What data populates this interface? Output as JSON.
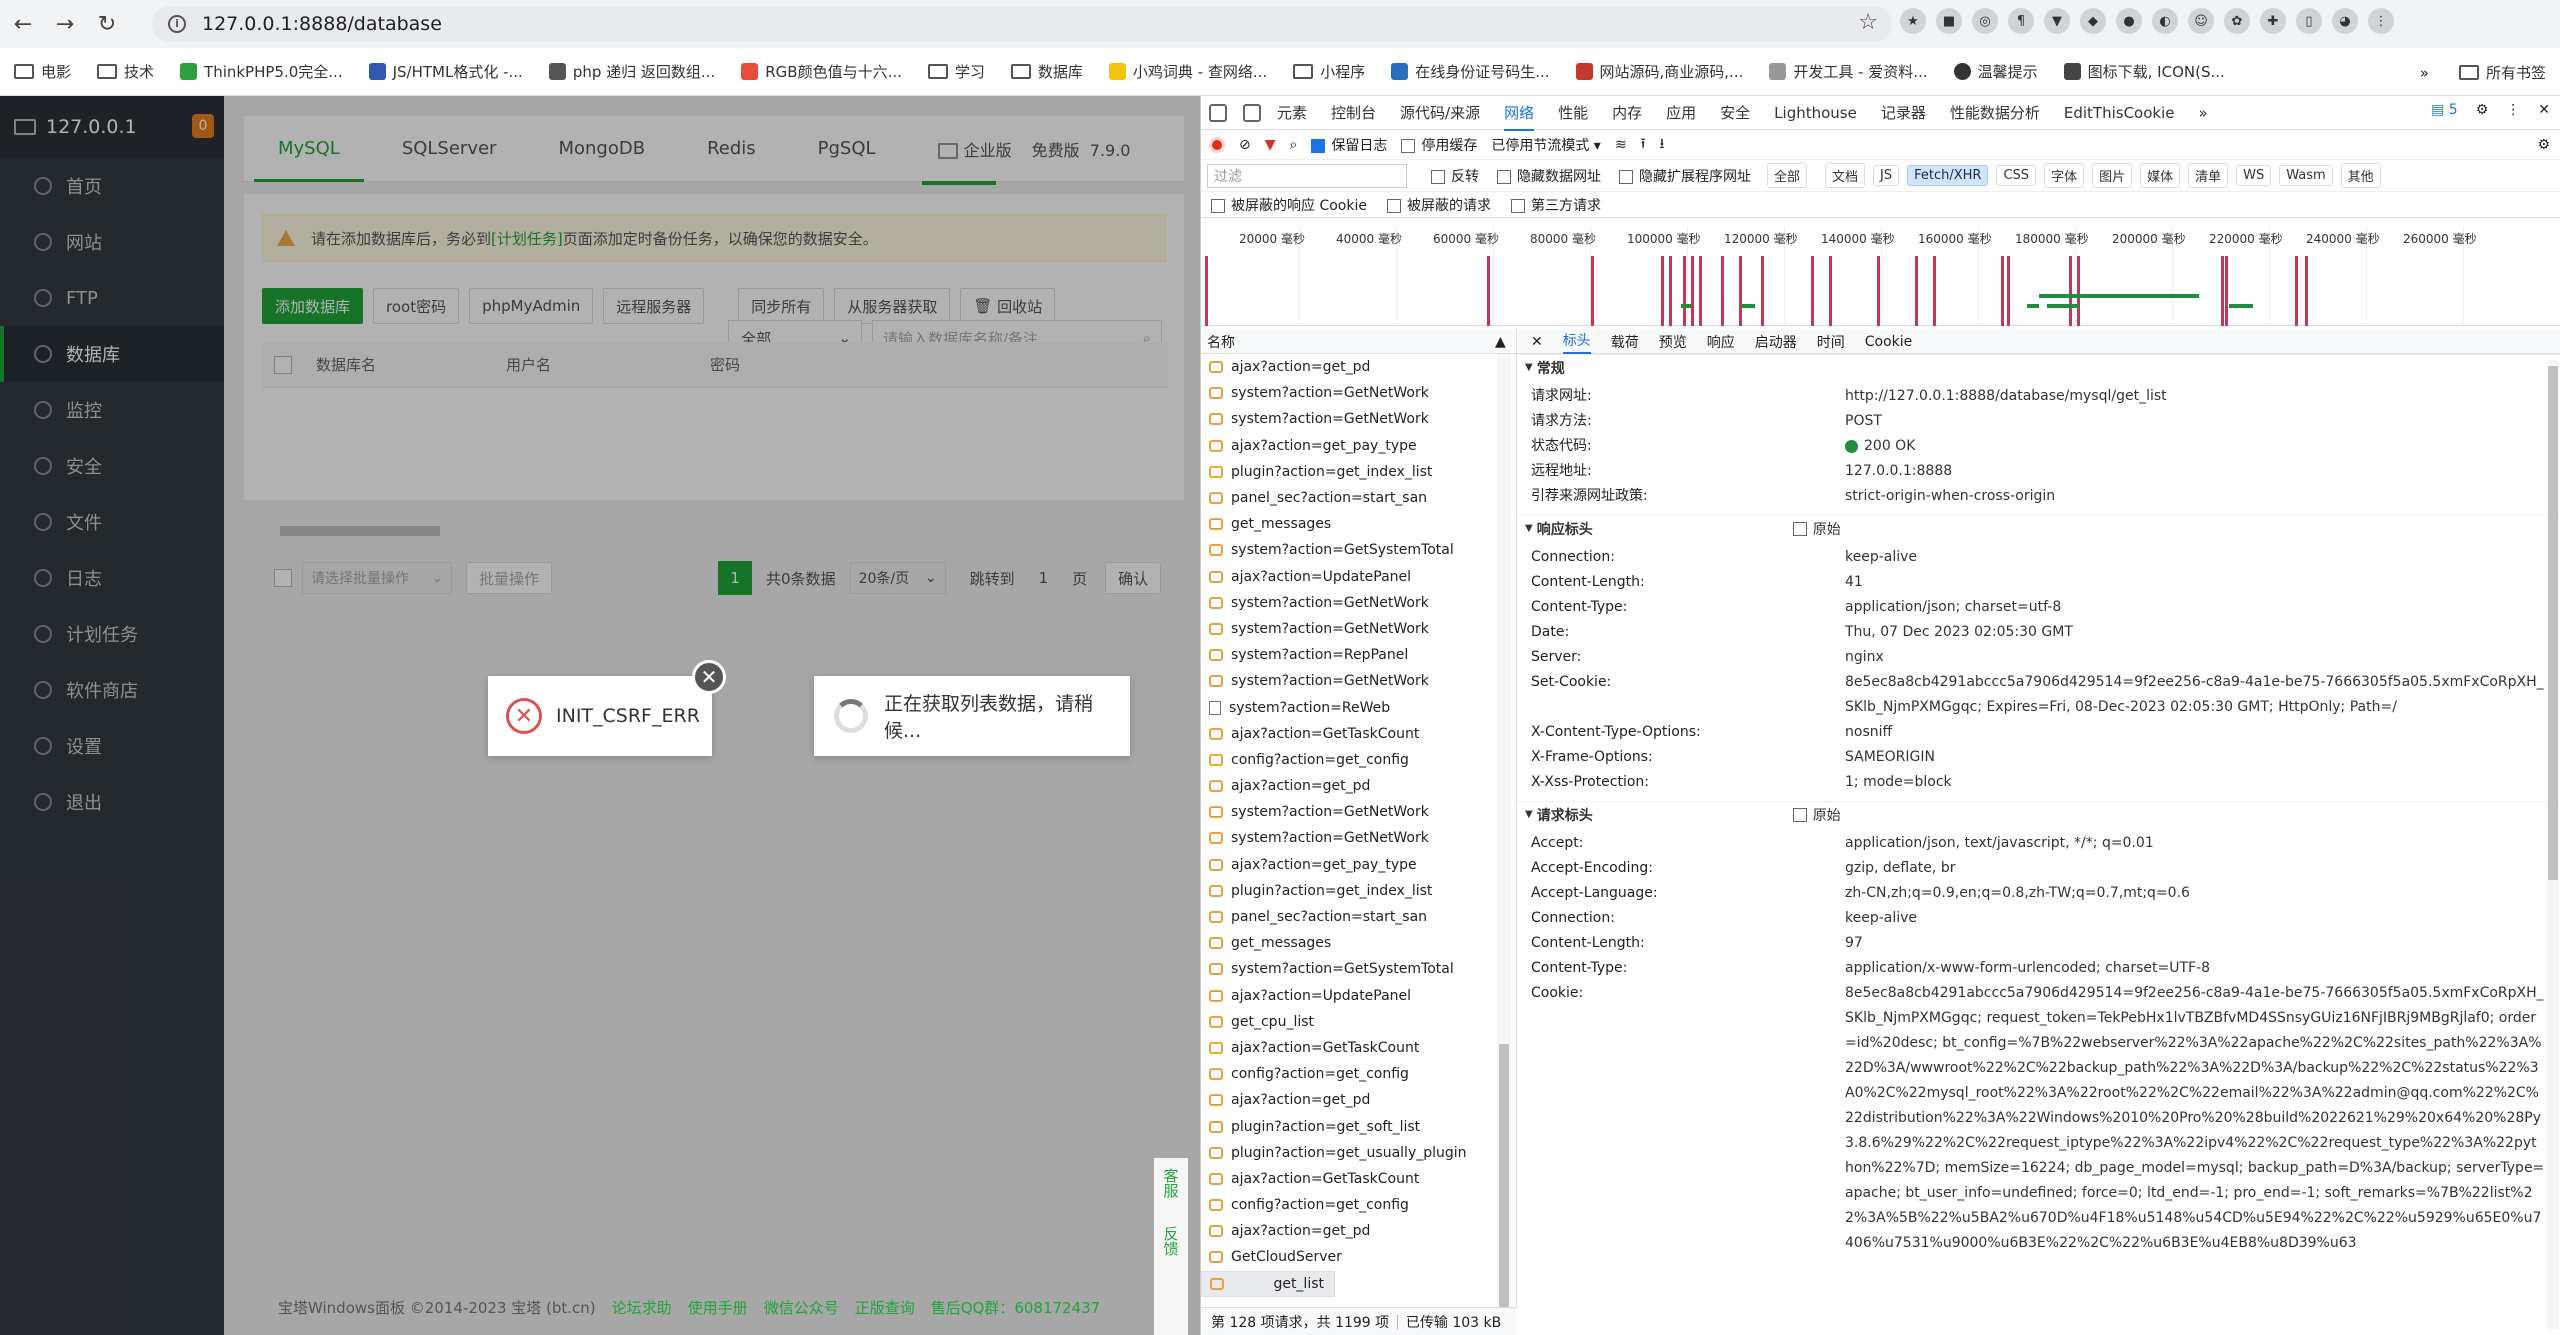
{
  "browser": {
    "url": "127.0.0.1:8888/database",
    "bookmarks": [
      "电影",
      "技术",
      "ThinkPHP5.0完全...",
      "JS/HTML格式化 -...",
      "php 递归 返回数组...",
      "RGB颜色值与十六...",
      "学习",
      "数据库",
      "小鸡词典 - 查网络...",
      "小程序",
      "在线身份证号码生...",
      "网站源码,商业源码,...",
      "开发工具 - 爱资料...",
      "温馨提示",
      "图标下载, ICON(S..."
    ],
    "bookmarks_overflow": "»",
    "all_bookmarks": "所有书签"
  },
  "panel": {
    "host": "127.0.0.1",
    "badge": "0",
    "sidebar": [
      "首页",
      "网站",
      "FTP",
      "数据库",
      "监控",
      "安全",
      "文件",
      "日志",
      "计划任务",
      "软件商店",
      "设置",
      "退出"
    ],
    "active_sidebar": "数据库",
    "tabs": [
      "MySQL",
      "SQLServer",
      "MongoDB",
      "Redis",
      "PgSQL"
    ],
    "pro_label": "企业版",
    "free_label": "免费版",
    "version": "7.9.0",
    "warning_before": "请在添加数据库后，务必到",
    "warning_link": "[计划任务]",
    "warning_after": "页面添加定时备份任务，以确保您的数据安全。",
    "toolbar": [
      "添加数据库",
      "root密码",
      "phpMyAdmin",
      "远程服务器",
      "同步所有",
      "从服务器获取",
      "回收站"
    ],
    "filter_all": "全部",
    "search_placeholder": "请输入数据库名称/备注",
    "columns": [
      "数据库名",
      "用户名",
      "密码"
    ],
    "batch_placeholder": "请选择批量操作",
    "batch_button": "批量操作",
    "page_current": "1",
    "total": "共0条数据",
    "per_page": "20条/页",
    "jump_label": "跳转到",
    "jump_value": "1",
    "page_label": "页",
    "confirm": "确认",
    "footer": {
      "copyright": "宝塔Windows面板 ©2014-2023 宝塔 (bt.cn)",
      "links": [
        "论坛求助",
        "使用手册",
        "微信公众号",
        "正版查询"
      ],
      "qq": "售后QQ群：608172437"
    },
    "float_kefu": "客服",
    "float_feedback": "反馈",
    "error_msg": "INIT_CSRF_ERR",
    "loading_msg": "正在获取列表数据，请稍候..."
  },
  "devtools": {
    "tabs": [
      "元素",
      "控制台",
      "源代码/来源",
      "网络",
      "性能",
      "内存",
      "应用",
      "安全",
      "Lighthouse",
      "记录器",
      "性能数据分析",
      "EditThisCookie"
    ],
    "active_tab": "网络",
    "issues_count": "5",
    "preserve_log": "保留日志",
    "disable_cache": "停用缓存",
    "throttle": "已停用节流模式",
    "filter_placeholder": "过滤",
    "invert": "反转",
    "hide_data_urls": "隐藏数据网址",
    "hide_ext_urls": "隐藏扩展程序网址",
    "types": [
      "全部",
      "文档",
      "JS",
      "Fetch/XHR",
      "CSS",
      "字体",
      "图片",
      "媒体",
      "清单",
      "WS",
      "Wasm",
      "其他"
    ],
    "active_type": "Fetch/XHR",
    "blocked_cookies": "被屏蔽的响应 Cookie",
    "blocked_requests": "被屏蔽的请求",
    "third_party": "第三方请求",
    "timeline": [
      "20000 毫秒",
      "40000 毫秒",
      "60000 毫秒",
      "80000 毫秒",
      "100000 毫秒",
      "120000 毫秒",
      "140000 毫秒",
      "160000 毫秒",
      "180000 毫秒",
      "200000 毫秒",
      "220000 毫秒",
      "240000 毫秒",
      "260000 毫秒"
    ],
    "name_header": "名称",
    "requests": [
      "ajax?action=get_pd",
      "system?action=GetNetWork",
      "system?action=GetNetWork",
      "ajax?action=get_pay_type",
      "plugin?action=get_index_list",
      "panel_sec?action=start_san",
      "get_messages",
      "system?action=GetSystemTotal",
      "ajax?action=UpdatePanel",
      "system?action=GetNetWork",
      "system?action=GetNetWork",
      "system?action=RepPanel",
      "system?action=GetNetWork",
      "system?action=ReWeb",
      "ajax?action=GetTaskCount",
      "config?action=get_config",
      "ajax?action=get_pd",
      "system?action=GetNetWork",
      "system?action=GetNetWork",
      "ajax?action=get_pay_type",
      "plugin?action=get_index_list",
      "panel_sec?action=start_san",
      "get_messages",
      "system?action=GetSystemTotal",
      "ajax?action=UpdatePanel",
      "get_cpu_list",
      "ajax?action=GetTaskCount",
      "config?action=get_config",
      "ajax?action=get_pd",
      "plugin?action=get_soft_list",
      "plugin?action=get_usually_plugin",
      "ajax?action=GetTaskCount",
      "config?action=get_config",
      "ajax?action=get_pd",
      "GetCloudServer",
      "get_list"
    ],
    "status_bar": [
      "第 128 项请求，共 1199 项",
      "已传输 103 kB"
    ],
    "detail_tabs": [
      "标头",
      "载荷",
      "预览",
      "响应",
      "启动器",
      "时间",
      "Cookie"
    ],
    "active_detail_tab": "标头",
    "general_title": "常规",
    "general": [
      {
        "k": "请求网址:",
        "v": "http://127.0.0.1:8888/database/mysql/get_list"
      },
      {
        "k": "请求方法:",
        "v": "POST"
      },
      {
        "k": "状态代码:",
        "v": "200 OK"
      },
      {
        "k": "远程地址:",
        "v": "127.0.0.1:8888"
      },
      {
        "k": "引荐来源网址政策:",
        "v": "strict-origin-when-cross-origin"
      }
    ],
    "response_title": "响应标头",
    "raw_label": "原始",
    "response_headers": [
      {
        "k": "Connection:",
        "v": "keep-alive"
      },
      {
        "k": "Content-Length:",
        "v": "41"
      },
      {
        "k": "Content-Type:",
        "v": "application/json; charset=utf-8"
      },
      {
        "k": "Date:",
        "v": "Thu, 07 Dec 2023 02:05:30 GMT"
      },
      {
        "k": "Server:",
        "v": "nginx"
      },
      {
        "k": "Set-Cookie:",
        "v": "8e5ec8a8cb4291abccc5a7906d429514=9f2ee256-c8a9-4a1e-be75-7666305f5a05.5xmFxCoRpXH_SKlb_NjmPXMGgqc; Expires=Fri, 08-Dec-2023 02:05:30 GMT; HttpOnly; Path=/"
      },
      {
        "k": "X-Content-Type-Options:",
        "v": "nosniff"
      },
      {
        "k": "X-Frame-Options:",
        "v": "SAMEORIGIN"
      },
      {
        "k": "X-Xss-Protection:",
        "v": "1; mode=block"
      }
    ],
    "request_title": "请求标头",
    "request_headers": [
      {
        "k": "Accept:",
        "v": "application/json, text/javascript, */*; q=0.01"
      },
      {
        "k": "Accept-Encoding:",
        "v": "gzip, deflate, br"
      },
      {
        "k": "Accept-Language:",
        "v": "zh-CN,zh;q=0.9,en;q=0.8,zh-TW;q=0.7,mt;q=0.6"
      },
      {
        "k": "Connection:",
        "v": "keep-alive"
      },
      {
        "k": "Content-Length:",
        "v": "97"
      },
      {
        "k": "Content-Type:",
        "v": "application/x-www-form-urlencoded; charset=UTF-8"
      },
      {
        "k": "Cookie:",
        "v": "8e5ec8a8cb4291abccc5a7906d429514=9f2ee256-c8a9-4a1e-be75-7666305f5a05.5xmFxCoRpXH_SKlb_NjmPXMGgqc; request_token=TekPebHx1lvTBZBfvMD4SSnsyGUiz16NFjIBRj9MBgRjlaf0; order=id%20desc; bt_config=%7B%22webserver%22%3A%22apache%22%2C%22sites_path%22%3A%22D%3A/wwwroot%22%2C%22backup_path%22%3A%22D%3A/backup%22%2C%22status%22%3A0%2C%22mysql_root%22%3A%22root%22%2C%22email%22%3A%22admin@qq.com%22%2C%22distribution%22%3A%22Windows%2010%20Pro%20%28build%2022621%29%20x64%20%28Py3.8.6%29%22%2C%22request_iptype%22%3A%22ipv4%22%2C%22request_type%22%3A%22python%22%7D; memSize=16224; db_page_model=mysql; backup_path=D%3A/backup; serverType=apache; bt_user_info=undefined; force=0; ltd_end=-1; pro_end=-1; soft_remarks=%7B%22list%22%3A%5B%22%u5BA2%u670D%u4F18%u5148%u54CD%u5E94%22%2C%22%u5929%u65E0%u7406%u7531%u9000%u6B3E%22%2C%22%u6B3E%u4EB8%u8D39%u63"
      }
    ]
  },
  "colors": {
    "bt_green": "#20a53a",
    "sidebar_bg": "#333a40",
    "devtools_blue": "#1a73e8"
  }
}
